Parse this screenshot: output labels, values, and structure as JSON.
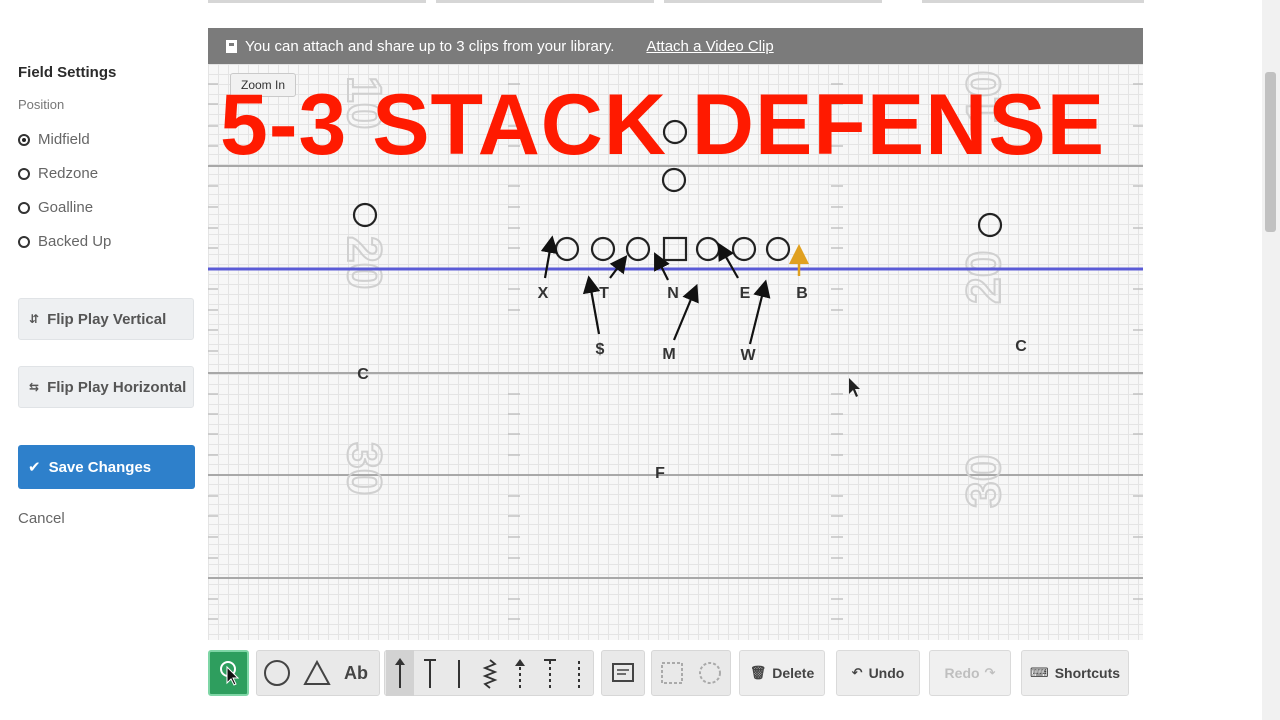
{
  "sidebar": {
    "title": "Field Settings",
    "position_label": "Position",
    "positions": [
      {
        "label": "Midfield",
        "selected": true
      },
      {
        "label": "Redzone",
        "selected": false
      },
      {
        "label": "Goalline",
        "selected": false
      },
      {
        "label": "Backed Up",
        "selected": false
      }
    ],
    "flip_vertical_label": "Flip Play Vertical",
    "flip_horizontal_label": "Flip Play Horizontal",
    "save_label": "Save Changes",
    "cancel_label": "Cancel"
  },
  "banner": {
    "message": "You can attach and share up to 3 clips from your library.",
    "link_label": "Attach a Video Clip"
  },
  "field": {
    "zoom_label": "Zoom In",
    "overlay_title": "5-3 STACK DEFENSE",
    "yard_numbers": {
      "top": "10",
      "mid": "20",
      "lower": "30"
    },
    "defender_labels": {
      "x": "X",
      "t": "T",
      "n": "N",
      "e": "E",
      "b": "B",
      "ss": "$",
      "m": "M",
      "w": "W",
      "cl": "C",
      "cr": "C",
      "f": "F"
    },
    "colors": {
      "line_of_scrimmage": "#5b5bd6",
      "highlight_route": "#e0a020",
      "title": "#ff1a00"
    }
  },
  "toolbar": {
    "text_tool": "Ab",
    "delete_label": "Delete",
    "undo_label": "Undo",
    "redo_label": "Redo",
    "shortcuts_label": "Shortcuts"
  }
}
